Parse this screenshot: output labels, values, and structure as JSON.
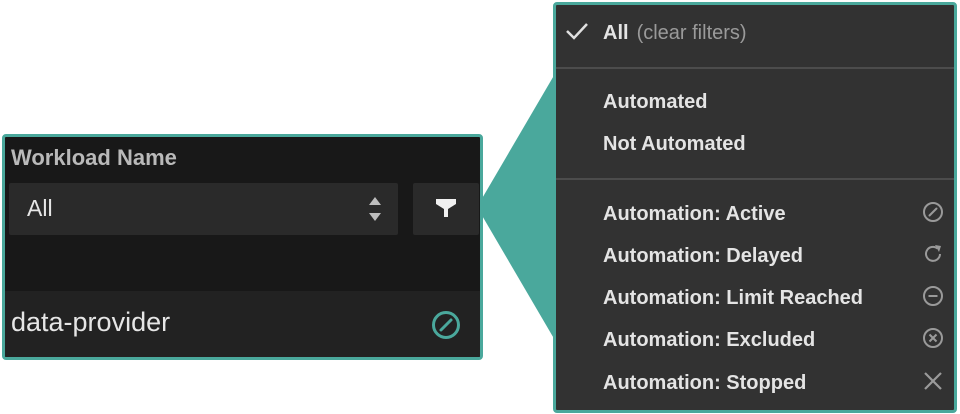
{
  "column": {
    "title": "Workload Name",
    "select_value": "All"
  },
  "row": {
    "name": "data-provider",
    "status_icon": "automation-active-icon"
  },
  "menu": {
    "all_label": "All",
    "all_sub": "(clear filters)",
    "group1": [
      "Automated",
      "Not Automated"
    ],
    "group2": [
      {
        "label": "Automation: Active",
        "icon": "active-icon"
      },
      {
        "label": "Automation: Delayed",
        "icon": "refresh-icon"
      },
      {
        "label": "Automation: Limit Reached",
        "icon": "minus-circle-icon"
      },
      {
        "label": "Automation: Excluded",
        "icon": "x-circle-icon"
      },
      {
        "label": "Automation: Stopped",
        "icon": "close-icon"
      }
    ]
  },
  "colors": {
    "accent": "#4aa89c",
    "panel_bg": "#181818",
    "menu_bg": "#323232"
  }
}
